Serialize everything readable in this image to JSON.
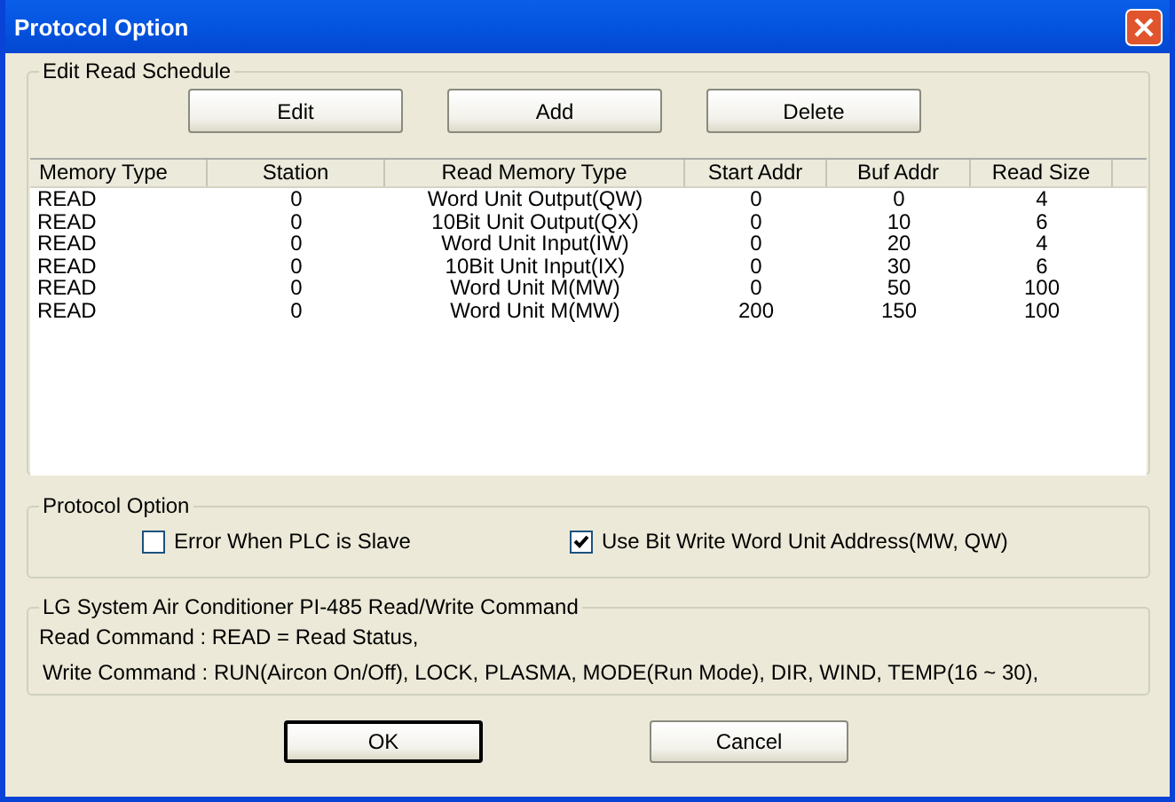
{
  "window": {
    "title": "Protocol Option"
  },
  "schedule": {
    "title": "Edit Read Schedule",
    "buttons": [
      "Edit",
      "Add",
      "Delete"
    ],
    "columns": [
      "Memory Type",
      "Station",
      "Read Memory Type",
      "Start Addr",
      "Buf Addr",
      "Read Size"
    ],
    "rows": [
      {
        "cells": [
          "READ",
          "0",
          "Word Unit Output(QW)",
          "0",
          "0",
          "4"
        ]
      },
      {
        "cells": [
          "READ",
          "0",
          "10Bit Unit Output(QX)",
          "0",
          "10",
          "6"
        ]
      },
      {
        "cells": [
          "READ",
          "0",
          "Word Unit Input(IW)",
          "0",
          "20",
          "4"
        ]
      },
      {
        "cells": [
          "READ",
          "0",
          "10Bit Unit Input(IX)",
          "0",
          "30",
          "6"
        ]
      },
      {
        "cells": [
          "READ",
          "0",
          "Word Unit M(MW)",
          "0",
          "50",
          "100"
        ]
      },
      {
        "cells": [
          "READ",
          "0",
          "Word Unit M(MW)",
          "200",
          "150",
          "100"
        ]
      }
    ]
  },
  "protocol_option": {
    "title": "Protocol Option",
    "options": [
      {
        "label": "Error When PLC is Slave",
        "checked": false
      },
      {
        "label": "Use Bit Write Word Unit Address(MW, QW)",
        "checked": true
      }
    ]
  },
  "command_info": {
    "title": "LG System Air Conditioner PI-485 Read/Write Command",
    "lines": [
      "Read Command : READ = Read Status,",
      "Write Command :  RUN(Aircon On/Off), LOCK, PLASMA, MODE(Run Mode), DIR, WIND, TEMP(16 ~ 30),"
    ]
  },
  "buttons": [
    {
      "label": "OK",
      "default": true
    },
    {
      "label": "Cancel",
      "default": false
    }
  ]
}
